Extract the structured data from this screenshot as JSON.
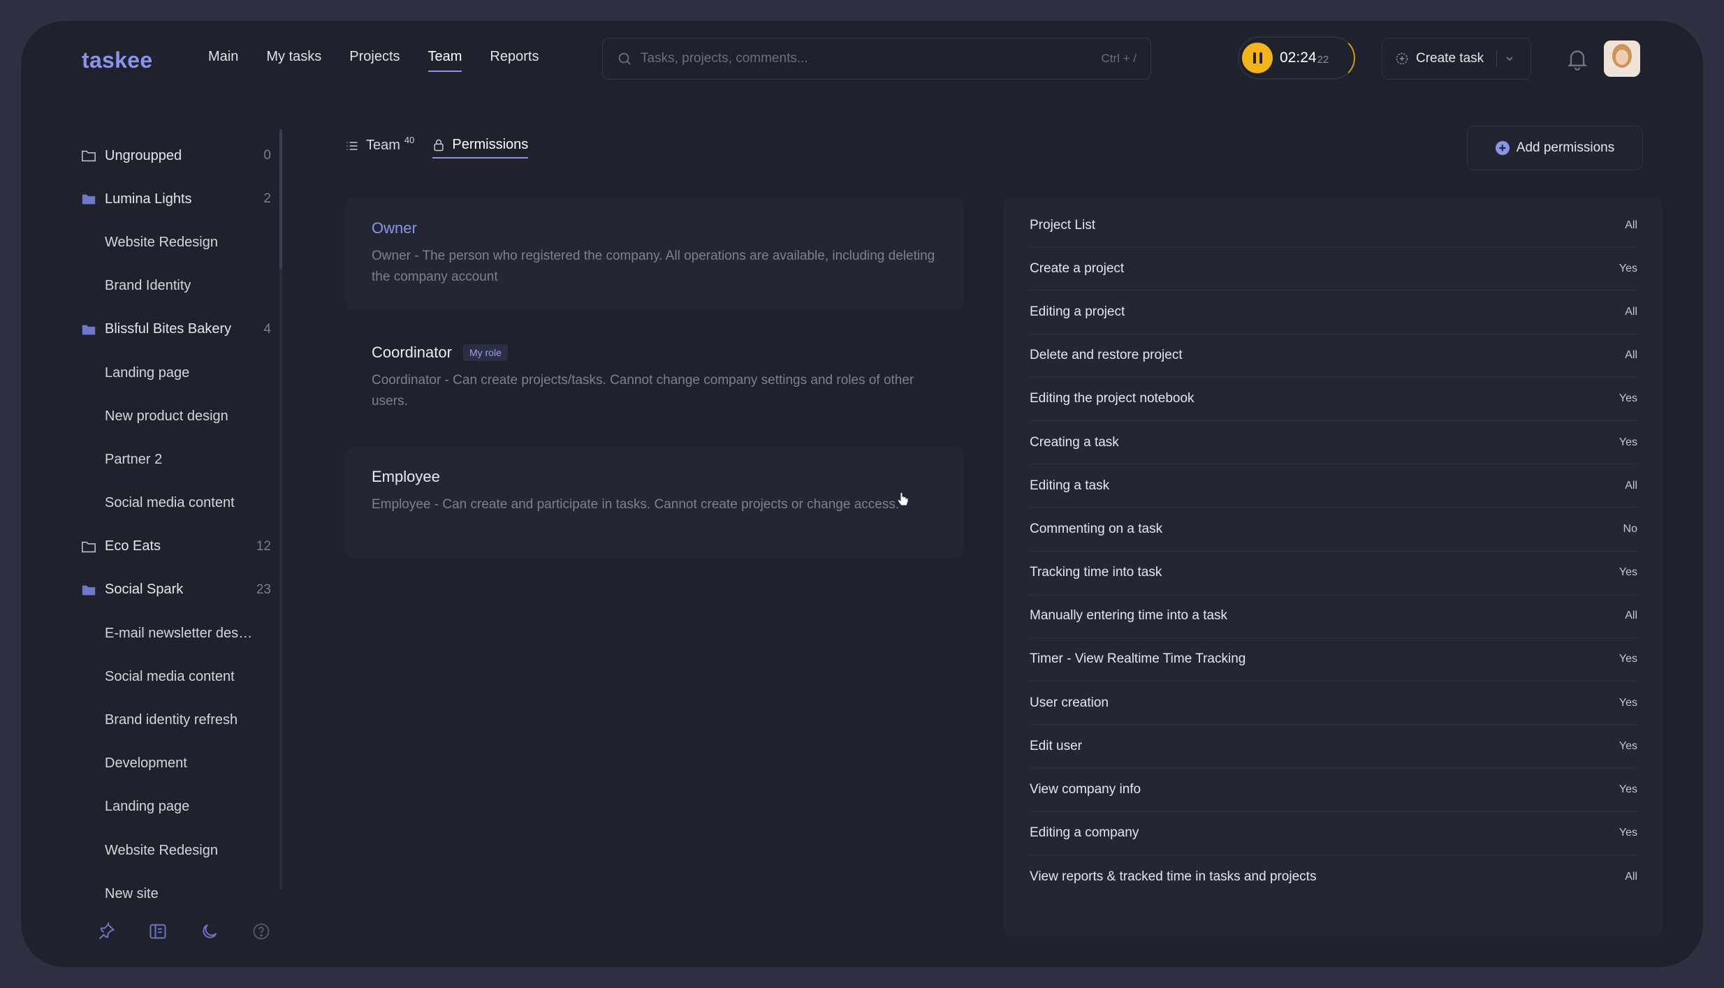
{
  "app": {
    "logo": "taskee",
    "nav": [
      "Main",
      "My tasks",
      "Projects",
      "Team",
      "Reports"
    ],
    "active_nav": "Team"
  },
  "search": {
    "placeholder": "Tasks, projects, comments...",
    "shortcut": "Ctrl + /"
  },
  "timer": {
    "time": "02:24",
    "seconds": "22"
  },
  "toolbar": {
    "create_task_label": "Create task"
  },
  "sidebar": {
    "items": [
      {
        "label": "Ungroupped",
        "count": "0",
        "type": "folder-outline"
      },
      {
        "label": "Lumina Lights",
        "count": "2",
        "type": "folder-filled"
      },
      {
        "label": "Website Redesign",
        "count": "",
        "type": "sub"
      },
      {
        "label": "Brand Identity",
        "count": "",
        "type": "sub"
      },
      {
        "label": "Blissful Bites Bakery",
        "count": "4",
        "type": "folder-filled"
      },
      {
        "label": "Landing page",
        "count": "",
        "type": "sub"
      },
      {
        "label": "New product design",
        "count": "",
        "type": "sub"
      },
      {
        "label": "Partner 2",
        "count": "",
        "type": "sub"
      },
      {
        "label": "Social media content",
        "count": "",
        "type": "sub"
      },
      {
        "label": "Eco Eats",
        "count": "12",
        "type": "folder-outline"
      },
      {
        "label": "Social Spark",
        "count": "23",
        "type": "folder-filled"
      },
      {
        "label": "E-mail newsletter desi...",
        "count": "",
        "type": "sub"
      },
      {
        "label": "Social media content",
        "count": "",
        "type": "sub"
      },
      {
        "label": "Brand identity refresh",
        "count": "",
        "type": "sub"
      },
      {
        "label": "Development",
        "count": "",
        "type": "sub"
      },
      {
        "label": "Landing page",
        "count": "",
        "type": "sub"
      },
      {
        "label": "Website Redesign",
        "count": "",
        "type": "sub"
      },
      {
        "label": "New site",
        "count": "",
        "type": "sub"
      }
    ]
  },
  "tabs": [
    {
      "label": "Team",
      "count": "40",
      "active": false
    },
    {
      "label": "Permissions",
      "count": "",
      "active": true
    }
  ],
  "add_permissions_label": "Add permissions",
  "roles": [
    {
      "title": "Owner",
      "badge": "",
      "description": "Owner - The person who registered the company. All operations are available, including deleting the company account"
    },
    {
      "title": "Coordinator",
      "badge": "My role",
      "description": "Coordinator - Can create projects/tasks. Cannot change company settings and roles of other users."
    },
    {
      "title": "Employee",
      "badge": "",
      "description": "Employee - Can create and participate in tasks. Cannot create projects or change access."
    }
  ],
  "permissions": [
    {
      "name": "Project List",
      "value": "All"
    },
    {
      "name": "Create a project",
      "value": "Yes"
    },
    {
      "name": "Editing a project",
      "value": "All"
    },
    {
      "name": "Delete and restore project",
      "value": "All"
    },
    {
      "name": "Editing the project notebook",
      "value": "Yes"
    },
    {
      "name": "Creating a task",
      "value": "Yes"
    },
    {
      "name": "Editing a task",
      "value": "All"
    },
    {
      "name": "Commenting on a task",
      "value": "No"
    },
    {
      "name": "Tracking time into task",
      "value": "Yes"
    },
    {
      "name": "Manually entering time into a task",
      "value": "All"
    },
    {
      "name": "Timer - View Realtime Time Tracking",
      "value": "Yes"
    },
    {
      "name": "User creation",
      "value": "Yes"
    },
    {
      "name": "Edit user",
      "value": "Yes"
    },
    {
      "name": "View company info",
      "value": "Yes"
    },
    {
      "name": "Editing a company",
      "value": "Yes"
    },
    {
      "name": "View reports & tracked time in tasks and projects",
      "value": "All"
    }
  ],
  "colors": {
    "background": "#1f212c",
    "frame": "#2e3142",
    "accent": "#8b95e8",
    "timer": "#f2b31b",
    "panel": "#242634"
  },
  "icons": [
    "search-icon",
    "pause-icon",
    "create-task-icon",
    "chevron-down-icon",
    "bell-icon",
    "folder-icon",
    "list-icon",
    "lock-icon",
    "plus-icon",
    "pin-icon",
    "sidebar-toggle-icon",
    "moon-icon",
    "help-icon"
  ]
}
